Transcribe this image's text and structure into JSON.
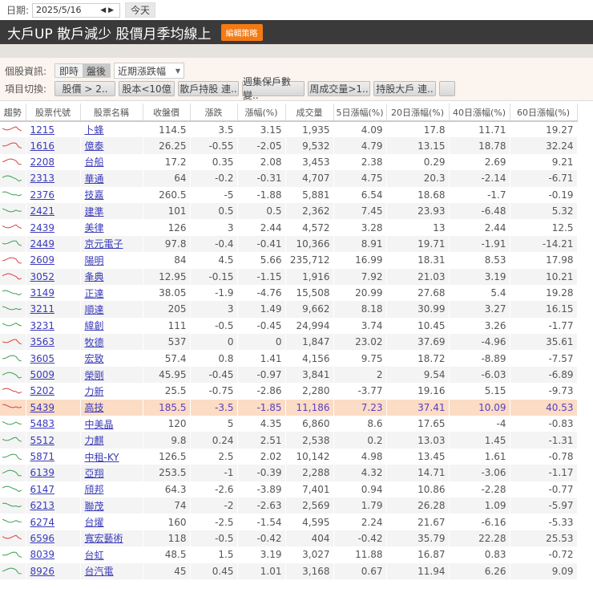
{
  "datebar": {
    "label": "日期:",
    "date": "2025/5/16",
    "today_label": "今天"
  },
  "header": {
    "title": "大戶UP 散戶減少  股價月季均線上",
    "edit_label": "編輯策略"
  },
  "controls": {
    "info_label": "個股資訊:",
    "realtime_label": "即時",
    "afterhours_label": "盤後",
    "dropdown_value": "近期漲跌幅",
    "switch_label": "項目切換:",
    "items": [
      "股價 > 2..",
      "股本<10億",
      "散戶持股 連..",
      "週集保戶數變..",
      "周成交量>1..",
      "持股大戶 連.."
    ]
  },
  "colors": {
    "up": "#e04040",
    "down": "#3aa050",
    "highlight": "#fbdcc4",
    "header_bg": "#3a3a3a",
    "accent": "#f47a14"
  },
  "table": {
    "headers": [
      "趨勢",
      "股票代號",
      "股票名稱",
      "收盤價",
      "漲跌",
      "漲幅(%)",
      "成交量",
      "5日漲幅(%)",
      "20日漲幅(%)",
      "40日漲幅(%)",
      "60日漲幅(%)"
    ],
    "highlight_code": "5439",
    "rows": [
      {
        "trend": "up",
        "code": "1215",
        "name": "卜蜂",
        "close": "114.5",
        "chg": "3.5",
        "pct": "3.15",
        "vol": "1,935",
        "d5": "4.09",
        "d20": "17.8",
        "d40": "11.71",
        "d60": "19.27"
      },
      {
        "trend": "up",
        "code": "1616",
        "name": "億泰",
        "close": "26.25",
        "chg": "-0.55",
        "pct": "-2.05",
        "vol": "9,532",
        "d5": "4.79",
        "d20": "13.15",
        "d40": "18.78",
        "d60": "32.24"
      },
      {
        "trend": "up",
        "code": "2208",
        "name": "台船",
        "close": "17.2",
        "chg": "0.35",
        "pct": "2.08",
        "vol": "3,453",
        "d5": "2.38",
        "d20": "0.29",
        "d40": "2.69",
        "d60": "9.21"
      },
      {
        "trend": "down",
        "code": "2313",
        "name": "華通",
        "close": "64",
        "chg": "-0.2",
        "pct": "-0.31",
        "vol": "4,707",
        "d5": "4.75",
        "d20": "20.3",
        "d40": "-2.14",
        "d60": "-6.71"
      },
      {
        "trend": "down",
        "code": "2376",
        "name": "技嘉",
        "close": "260.5",
        "chg": "-5",
        "pct": "-1.88",
        "vol": "5,881",
        "d5": "6.54",
        "d20": "18.68",
        "d40": "-1.7",
        "d60": "-0.19"
      },
      {
        "trend": "down",
        "code": "2421",
        "name": "建準",
        "close": "101",
        "chg": "0.5",
        "pct": "0.5",
        "vol": "2,362",
        "d5": "7.45",
        "d20": "23.93",
        "d40": "-6.48",
        "d60": "5.32"
      },
      {
        "trend": "up",
        "code": "2439",
        "name": "美律",
        "close": "126",
        "chg": "3",
        "pct": "2.44",
        "vol": "4,572",
        "d5": "3.28",
        "d20": "13",
        "d40": "2.44",
        "d60": "12.5"
      },
      {
        "trend": "down",
        "code": "2449",
        "name": "京元電子",
        "close": "97.8",
        "chg": "-0.4",
        "pct": "-0.41",
        "vol": "10,366",
        "d5": "8.91",
        "d20": "19.71",
        "d40": "-1.91",
        "d60": "-14.21"
      },
      {
        "trend": "up",
        "code": "2609",
        "name": "陽明",
        "close": "84",
        "chg": "4.5",
        "pct": "5.66",
        "vol": "235,712",
        "d5": "16.99",
        "d20": "18.31",
        "d40": "8.53",
        "d60": "17.98"
      },
      {
        "trend": "up",
        "code": "3052",
        "name": "夆典",
        "close": "12.95",
        "chg": "-0.15",
        "pct": "-1.15",
        "vol": "1,916",
        "d5": "7.92",
        "d20": "21.03",
        "d40": "3.19",
        "d60": "10.21"
      },
      {
        "trend": "down",
        "code": "3149",
        "name": "正達",
        "close": "38.05",
        "chg": "-1.9",
        "pct": "-4.76",
        "vol": "15,508",
        "d5": "20.99",
        "d20": "27.68",
        "d40": "5.4",
        "d60": "19.28"
      },
      {
        "trend": "down",
        "code": "3211",
        "name": "順達",
        "close": "205",
        "chg": "3",
        "pct": "1.49",
        "vol": "9,662",
        "d5": "8.18",
        "d20": "30.99",
        "d40": "3.27",
        "d60": "16.15"
      },
      {
        "trend": "down",
        "code": "3231",
        "name": "緯創",
        "close": "111",
        "chg": "-0.5",
        "pct": "-0.45",
        "vol": "24,994",
        "d5": "3.74",
        "d20": "10.45",
        "d40": "3.26",
        "d60": "-1.77"
      },
      {
        "trend": "up",
        "code": "3563",
        "name": "牧德",
        "close": "537",
        "chg": "0",
        "pct": "0",
        "vol": "1,847",
        "d5": "23.02",
        "d20": "37.69",
        "d40": "-4.96",
        "d60": "35.61"
      },
      {
        "trend": "down",
        "code": "3605",
        "name": "宏致",
        "close": "57.4",
        "chg": "0.8",
        "pct": "1.41",
        "vol": "4,156",
        "d5": "9.75",
        "d20": "18.72",
        "d40": "-8.89",
        "d60": "-7.57"
      },
      {
        "trend": "down",
        "code": "5009",
        "name": "榮剛",
        "close": "45.95",
        "chg": "-0.45",
        "pct": "-0.97",
        "vol": "3,841",
        "d5": "2",
        "d20": "9.54",
        "d40": "-6.03",
        "d60": "-6.89"
      },
      {
        "trend": "up",
        "code": "5202",
        "name": "力新",
        "close": "25.5",
        "chg": "-0.75",
        "pct": "-2.86",
        "vol": "2,280",
        "d5": "-3.77",
        "d20": "19.16",
        "d40": "5.15",
        "d60": "-9.73"
      },
      {
        "trend": "up",
        "code": "5439",
        "name": "高技",
        "close": "185.5",
        "chg": "-3.5",
        "pct": "-1.85",
        "vol": "11,186",
        "d5": "7.23",
        "d20": "37.41",
        "d40": "10.09",
        "d60": "40.53"
      },
      {
        "trend": "down",
        "code": "5483",
        "name": "中美晶",
        "close": "120",
        "chg": "5",
        "pct": "4.35",
        "vol": "6,860",
        "d5": "8.6",
        "d20": "17.65",
        "d40": "-4",
        "d60": "-0.83"
      },
      {
        "trend": "down",
        "code": "5512",
        "name": "力麒",
        "close": "9.8",
        "chg": "0.24",
        "pct": "2.51",
        "vol": "2,538",
        "d5": "0.2",
        "d20": "13.03",
        "d40": "1.45",
        "d60": "-1.31"
      },
      {
        "trend": "down",
        "code": "5871",
        "name": "中租-KY",
        "close": "126.5",
        "chg": "2.5",
        "pct": "2.02",
        "vol": "10,142",
        "d5": "4.98",
        "d20": "13.45",
        "d40": "1.61",
        "d60": "-0.78"
      },
      {
        "trend": "down",
        "code": "6139",
        "name": "亞翔",
        "close": "253.5",
        "chg": "-1",
        "pct": "-0.39",
        "vol": "2,288",
        "d5": "4.32",
        "d20": "14.71",
        "d40": "-3.06",
        "d60": "-1.17"
      },
      {
        "trend": "down",
        "code": "6147",
        "name": "頎邦",
        "close": "64.3",
        "chg": "-2.6",
        "pct": "-3.89",
        "vol": "7,401",
        "d5": "0.94",
        "d20": "10.86",
        "d40": "-2.28",
        "d60": "-0.77"
      },
      {
        "trend": "down",
        "code": "6213",
        "name": "聯茂",
        "close": "74",
        "chg": "-2",
        "pct": "-2.63",
        "vol": "2,569",
        "d5": "1.79",
        "d20": "26.28",
        "d40": "1.09",
        "d60": "-5.97"
      },
      {
        "trend": "down",
        "code": "6274",
        "name": "台燿",
        "close": "160",
        "chg": "-2.5",
        "pct": "-1.54",
        "vol": "4,595",
        "d5": "2.24",
        "d20": "21.67",
        "d40": "-6.16",
        "d60": "-5.33"
      },
      {
        "trend": "up",
        "code": "6596",
        "name": "寬宏藝術",
        "close": "118",
        "chg": "-0.5",
        "pct": "-0.42",
        "vol": "404",
        "d5": "-0.42",
        "d20": "35.79",
        "d40": "22.28",
        "d60": "25.53"
      },
      {
        "trend": "down",
        "code": "8039",
        "name": "台虹",
        "close": "48.5",
        "chg": "1.5",
        "pct": "3.19",
        "vol": "3,027",
        "d5": "11.88",
        "d20": "16.87",
        "d40": "0.83",
        "d60": "-0.72"
      },
      {
        "trend": "down",
        "code": "8926",
        "name": "台汽電",
        "close": "45",
        "chg": "0.45",
        "pct": "1.01",
        "vol": "3,168",
        "d5": "0.67",
        "d20": "11.94",
        "d40": "6.26",
        "d60": "9.09"
      }
    ]
  }
}
